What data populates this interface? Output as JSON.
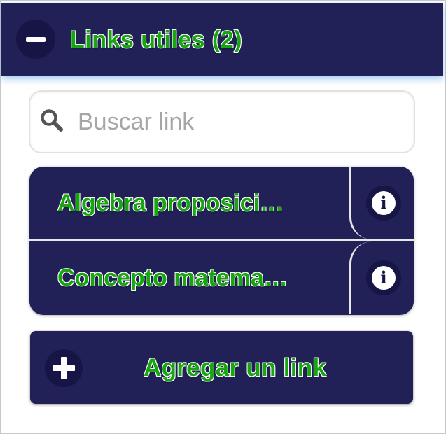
{
  "panel": {
    "title": "Links utiles (2)"
  },
  "search": {
    "placeholder": "Buscar link",
    "value": ""
  },
  "links": [
    {
      "label": "Algebra proposici…"
    },
    {
      "label": "Concepto matema…"
    }
  ],
  "actions": {
    "add_label": "Agregar un link"
  },
  "icons": {
    "collapse": "minus-circle-icon",
    "search": "search-icon",
    "info": "info-icon",
    "add": "plus-circle-icon"
  },
  "colors": {
    "panel_bg": "#212057",
    "label_text": "#17a510",
    "icon_circle": "#161545"
  }
}
